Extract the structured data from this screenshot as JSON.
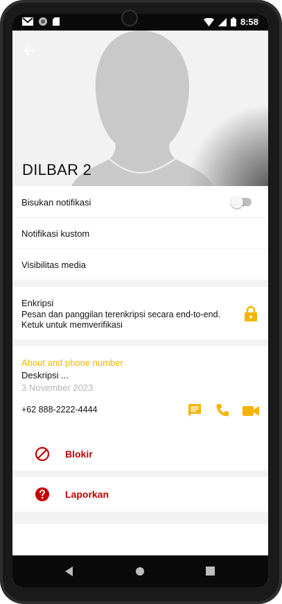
{
  "status_bar": {
    "time": "8:58",
    "left_icons": [
      "gmail-icon",
      "circle-icon",
      "sd-card-icon"
    ],
    "right_icons": [
      "wifi-icon",
      "signal-icon",
      "battery-icon"
    ]
  },
  "header": {
    "title": "DILBAR 2",
    "back_icon": "arrow-left-icon"
  },
  "settings": {
    "mute_label": "Bisukan notifikasi",
    "mute_enabled": false,
    "custom_label": "Notifikasi kustom",
    "media_label": "Visibilitas media"
  },
  "encryption": {
    "title": "Enkripsi",
    "desc_line1": "Pesan dan panggilan terenkripsi secara end-to-end.",
    "desc_line2": "Ketuk untuk memverifikasi",
    "icon": "lock-icon"
  },
  "about": {
    "heading": "About and phone number",
    "description": "Deskripsi ...",
    "date": "3 November 2023",
    "phone": "+62 888-2222-4444"
  },
  "actions": {
    "block_label": "Blokir",
    "report_label": "Laporkan"
  },
  "colors": {
    "accent": "#f5b400",
    "danger": "#c40000"
  }
}
